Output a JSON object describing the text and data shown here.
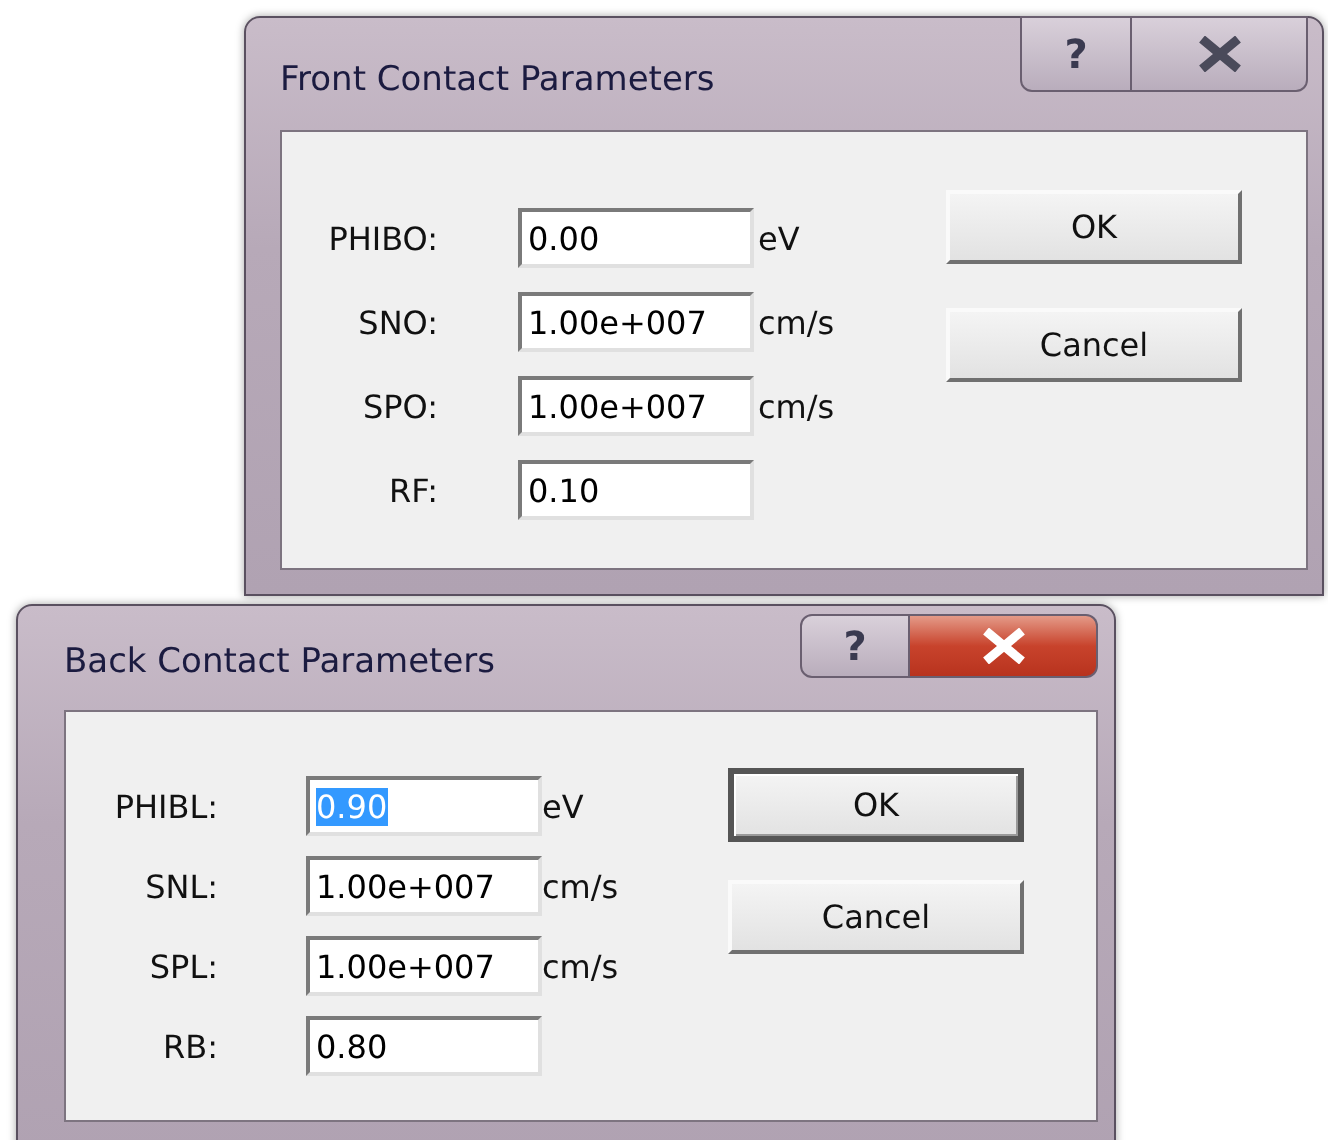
{
  "dialogs": [
    {
      "title": "Front Contact Parameters",
      "active": false,
      "help_glyph": "?",
      "fields": [
        {
          "label": "PHIBO:",
          "value": "0.00",
          "unit": "eV",
          "text_selected": false
        },
        {
          "label": "SNO:",
          "value": "1.00e+007",
          "unit": "cm/s",
          "text_selected": false
        },
        {
          "label": "SPO:",
          "value": "1.00e+007",
          "unit": "cm/s",
          "text_selected": false
        },
        {
          "label": "RF:",
          "value": "0.10",
          "text_selected": false
        }
      ],
      "buttons": [
        {
          "label": "OK",
          "default": false
        },
        {
          "label": "Cancel",
          "default": false
        }
      ]
    },
    {
      "title": "Back Contact Parameters",
      "active": true,
      "help_glyph": "?",
      "fields": [
        {
          "label": "PHIBL:",
          "value": "0.90",
          "unit": "eV",
          "text_selected": true
        },
        {
          "label": "SNL:",
          "value": "1.00e+007",
          "unit": "cm/s",
          "text_selected": false
        },
        {
          "label": "SPL:",
          "value": "1.00e+007",
          "unit": "cm/s",
          "text_selected": false
        },
        {
          "label": "RB:",
          "value": "0.80",
          "text_selected": false
        }
      ],
      "buttons": [
        {
          "label": "OK",
          "default": true
        },
        {
          "label": "Cancel",
          "default": false
        }
      ]
    }
  ]
}
